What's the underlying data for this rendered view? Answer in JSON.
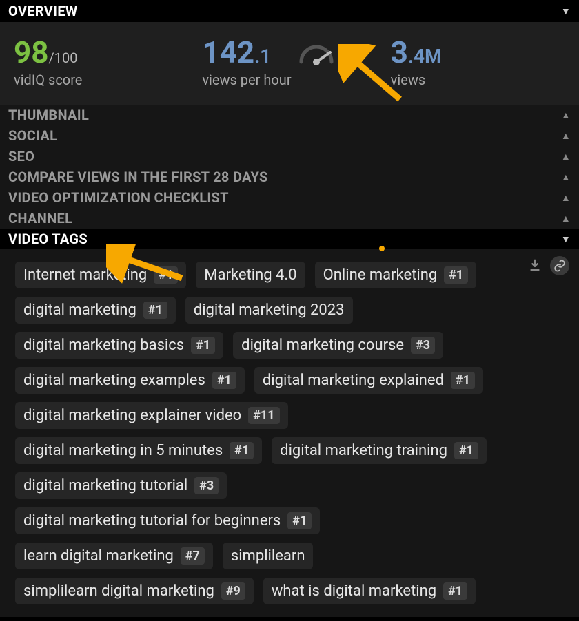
{
  "sections": {
    "overview": {
      "title": "OVERVIEW"
    },
    "thumbnail": {
      "title": "THUMBNAIL"
    },
    "social": {
      "title": "SOCIAL"
    },
    "seo": {
      "title": "SEO"
    },
    "compare": {
      "title": "COMPARE VIEWS IN THE FIRST 28 DAYS"
    },
    "checklist": {
      "title": "VIDEO OPTIMIZATION CHECKLIST"
    },
    "channel": {
      "title": "CHANNEL"
    },
    "videoTags": {
      "title": "VIDEO TAGS"
    }
  },
  "overview": {
    "score": {
      "value": "98",
      "max": "/100",
      "label": "vidIQ score"
    },
    "vph": {
      "int": "142",
      "dec": ".1",
      "label": "views per hour"
    },
    "views": {
      "int": "3",
      "dec": ".4",
      "suffix": "M",
      "label": "views"
    }
  },
  "tags": [
    {
      "text": "Internet marketing",
      "rank": "#1"
    },
    {
      "text": "Marketing 4.0",
      "rank": null
    },
    {
      "text": "Online marketing",
      "rank": "#1"
    },
    {
      "text": "digital marketing",
      "rank": "#1"
    },
    {
      "text": "digital marketing 2023",
      "rank": null
    },
    {
      "text": "digital marketing basics",
      "rank": "#1"
    },
    {
      "text": "digital marketing course",
      "rank": "#3"
    },
    {
      "text": "digital marketing examples",
      "rank": "#1"
    },
    {
      "text": "digital marketing explained",
      "rank": "#1"
    },
    {
      "text": "digital marketing explainer video",
      "rank": "#11"
    },
    {
      "text": "digital marketing in 5 minutes",
      "rank": "#1"
    },
    {
      "text": "digital marketing training",
      "rank": "#1"
    },
    {
      "text": "digital marketing tutorial",
      "rank": "#3"
    },
    {
      "text": "digital marketing tutorial for beginners",
      "rank": "#1"
    },
    {
      "text": "learn digital marketing",
      "rank": "#7"
    },
    {
      "text": "simplilearn",
      "rank": null
    },
    {
      "text": "simplilearn digital marketing",
      "rank": "#9"
    },
    {
      "text": "what is digital marketing",
      "rank": "#1"
    }
  ]
}
